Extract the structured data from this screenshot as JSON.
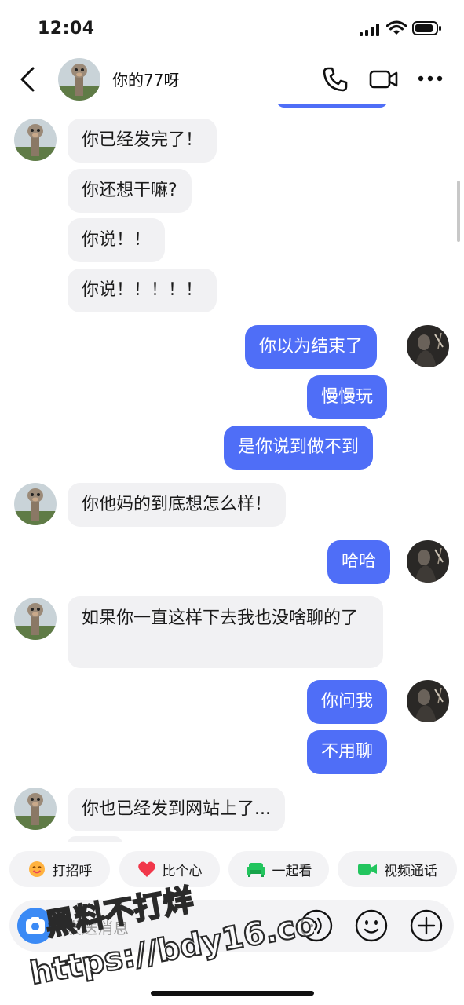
{
  "status_bar": {
    "time": "12:04"
  },
  "header": {
    "title": "你的77呀"
  },
  "messages": [
    {
      "dir": "in",
      "text": "你已经发完了！"
    },
    {
      "dir": "in",
      "text": "你还想干嘛?"
    },
    {
      "dir": "in",
      "text": "你说！！"
    },
    {
      "dir": "in",
      "text": "你说！！！！！"
    },
    {
      "dir": "out",
      "text": "你以为结束了"
    },
    {
      "dir": "out",
      "text": "慢慢玩"
    },
    {
      "dir": "out",
      "text": "是你说到做不到"
    },
    {
      "dir": "in",
      "text": "你他妈的到底想怎么样！"
    },
    {
      "dir": "out",
      "text": "哈哈"
    },
    {
      "dir": "in",
      "text": "如果你一直这样下去我也没啥聊的了"
    },
    {
      "dir": "out",
      "text": "你问我"
    },
    {
      "dir": "out",
      "text": "不用聊"
    },
    {
      "dir": "in",
      "text": "你也已经发到网站上了..."
    }
  ],
  "quick_actions": [
    {
      "label": "打招呼",
      "icon": "smile-sticker-icon"
    },
    {
      "label": "比个心",
      "icon": "heart-icon"
    },
    {
      "label": "一起看",
      "icon": "sofa-icon"
    },
    {
      "label": "视频通话",
      "icon": "video-camera-icon"
    }
  ],
  "input": {
    "placeholder": "发送消息"
  },
  "watermark": {
    "line1": "黑料不打烊",
    "line2": "https://bdy16.co"
  },
  "colors": {
    "outgoing_bubble": "#4f6ef7",
    "incoming_bubble": "#f1f1f3",
    "camera_button": "#3b8af5"
  }
}
